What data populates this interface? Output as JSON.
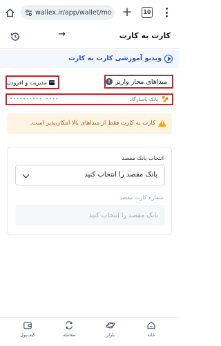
{
  "browser": {
    "url": "wallex.ir/app/wallet/mo",
    "tab_count": "10"
  },
  "header": {
    "title": "کارت به کارت",
    "back_arrow": "→"
  },
  "video": {
    "label": "ویدیو آموزشی کارت به کارت"
  },
  "sources": {
    "title": "مبداهای مجاز واریز",
    "manage_label": "مدیریت و افزودن",
    "info_glyph": "!",
    "bank_name": "بانک پاسارگاد",
    "card_masked": "•••••••••• ••••"
  },
  "warning": {
    "text": "کارت به کارت فقط از مبداهای بالا امکان‌پذیر است.",
    "color": "#b45309"
  },
  "form": {
    "dest_bank_label": "انتخاب بانک مقصد",
    "dest_bank_value": "بانک مقصد را انتخاب کنید",
    "dest_card_label": "شماره کارت مقصد",
    "dest_card_placeholder": "بانک مقصد را انتخاب کنید",
    "dest_card_value": ""
  },
  "bottom_nav": {
    "items": [
      {
        "label": "خانه",
        "icon": "home-icon"
      },
      {
        "label": "بازار",
        "icon": "market-icon"
      },
      {
        "label": "معامله",
        "icon": "trade-icon"
      },
      {
        "label": "کیف‌پول",
        "icon": "wallet-icon"
      }
    ]
  },
  "colors": {
    "accent": "#1d4ed8",
    "highlight_border": "#c0252d",
    "warning_bg": "#fdf4e4"
  }
}
